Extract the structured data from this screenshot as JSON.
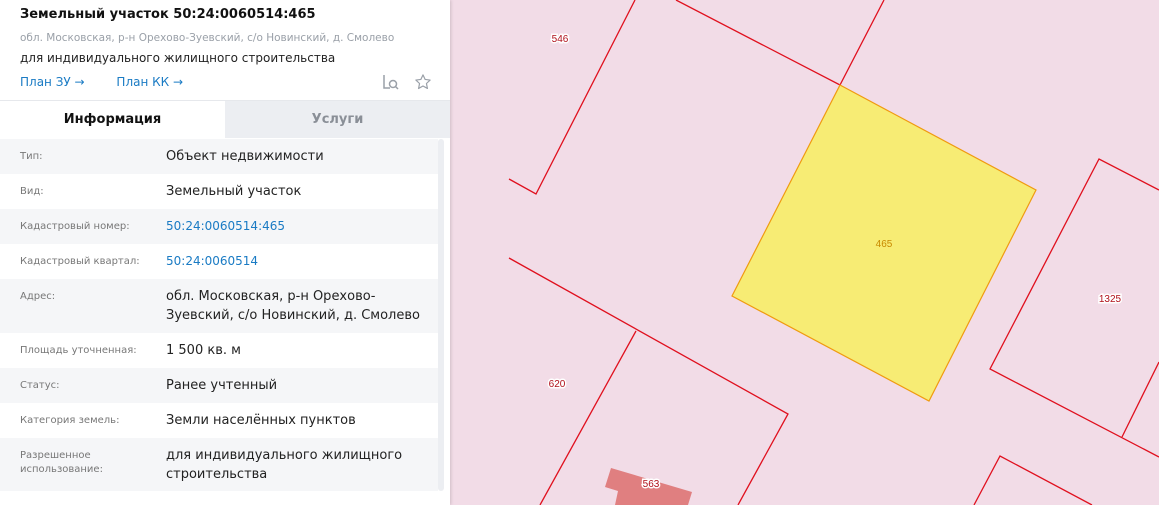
{
  "header": {
    "title": "Земельный участок 50:24:0060514:465",
    "address": "обл. Московская, р-н Орехово-Зуевский, с/о Новинский, д. Смолево",
    "use": "для индивидуального жилищного строительства",
    "links": [
      "План ЗУ →",
      "План КК →"
    ],
    "icons": [
      "search-document-icon",
      "star-icon"
    ]
  },
  "tabs": [
    {
      "label": "Информация",
      "active": true
    },
    {
      "label": "Услуги",
      "active": false
    }
  ],
  "rows": [
    {
      "key": "Тип:",
      "value": "Объект недвижимости"
    },
    {
      "key": "Вид:",
      "value": "Земельный участок"
    },
    {
      "key": "Кадастровый номер:",
      "value": "50:24:0060514:465"
    },
    {
      "key": "Кадастровый квартал:",
      "value": "50:24:0060514"
    },
    {
      "key": "Адрес:",
      "value": "обл. Московская, р-н Орехово-Зуевский, с/о Новинский, д. Смолево"
    },
    {
      "key": "Площадь уточненная:",
      "value": "1 500 кв. м"
    },
    {
      "key": "Статус:",
      "value": "Ранее учтенный"
    },
    {
      "key": "Категория земель:",
      "value": "Земли населённых пунктов"
    },
    {
      "key": "Разрешенное использование:",
      "value": "для индивидуального жилищного строительства"
    }
  ],
  "map": {
    "labels": {
      "p546": "546",
      "p465": "465",
      "p1325": "1325",
      "p620": "620",
      "p563": "563"
    },
    "colors": {
      "background": "#f2dce7",
      "border": "#e0101e",
      "selected": "#f7ec74",
      "building": "#e07f80"
    }
  }
}
